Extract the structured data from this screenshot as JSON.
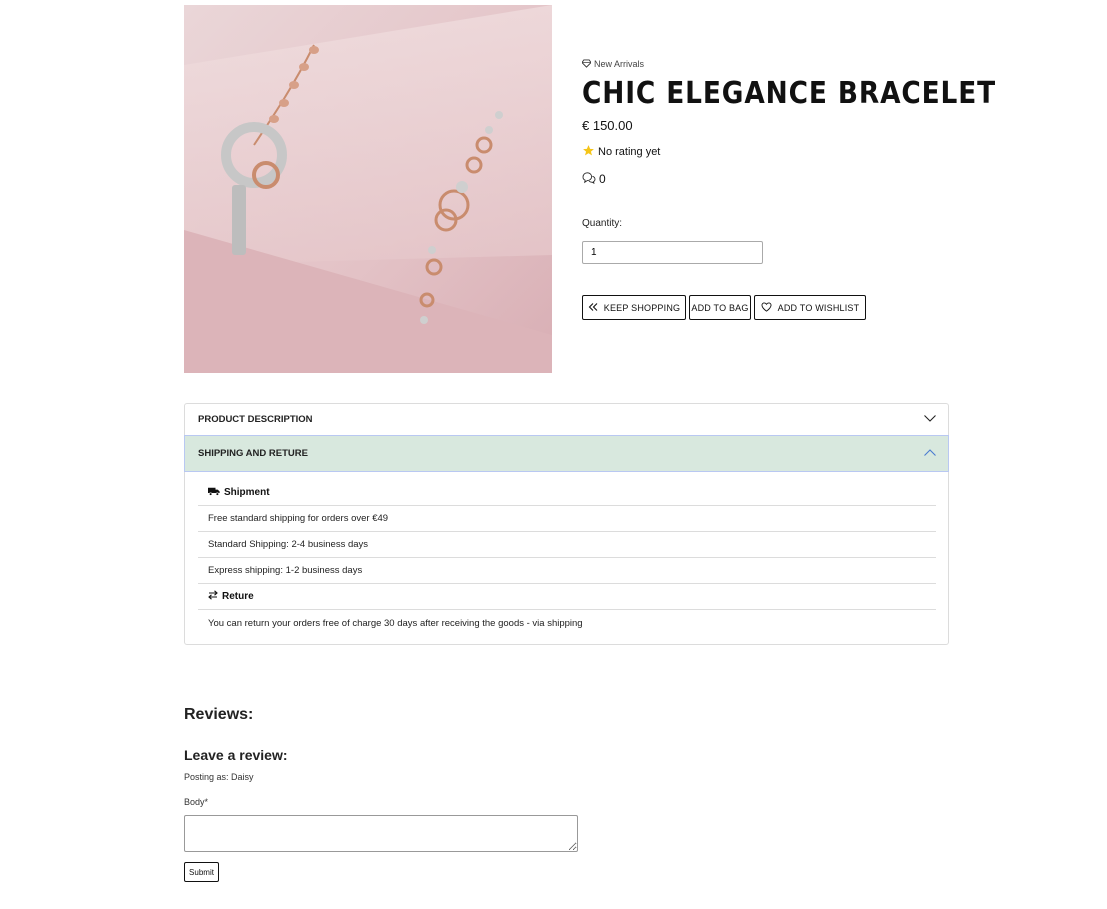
{
  "product": {
    "category": "New Arrivals",
    "category_icon": "gem-icon",
    "title": "CHIC ELEGANCE BRACELET",
    "price": "€ 150.00",
    "rating_text": "No rating yet",
    "comment_count": "0",
    "quantity_label": "Quantity:",
    "quantity_value": "1"
  },
  "actions": {
    "keep_shopping": "KEEP SHOPPING",
    "add_to_bag": "ADD TO BAG",
    "add_to_wishlist": "ADD TO WISHLIST"
  },
  "accordion": {
    "description_label": "PRODUCT DESCRIPTION",
    "shipping_label": "SHIPPING AND RETURE",
    "shipment_heading": "Shipment",
    "shipment_lines": [
      "Free standard shipping for orders over €49",
      "Standard Shipping: 2-4 business days",
      "Express shipping: 1-2 business days"
    ],
    "return_heading": "Reture",
    "return_line": "You can return your orders free of charge 30 days after receiving the goods - via shipping"
  },
  "reviews": {
    "title": "Reviews:",
    "leave_title": "Leave a review:",
    "posting_as": "Posting as: Daisy",
    "body_label": "Body*",
    "submit": "Submit"
  },
  "colors": {
    "accent_open": "#d8e8de",
    "star": "#f5c518",
    "image_bg": "#e8c9cc"
  }
}
